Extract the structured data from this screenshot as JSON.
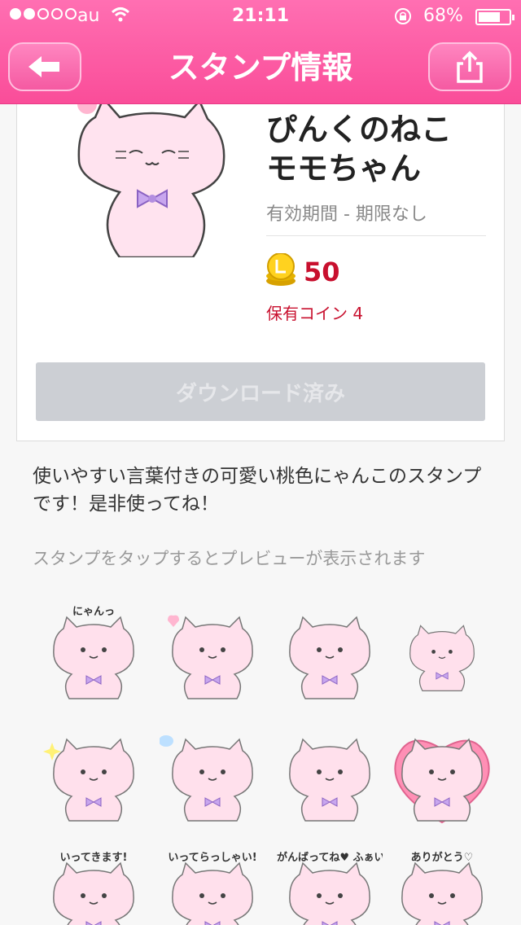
{
  "status_bar": {
    "carrier": "au",
    "time": "21:11",
    "battery": "68%",
    "battery_level": 0.68
  },
  "nav": {
    "title": "スタンプ情報",
    "back_icon": "back-arrow-icon",
    "share_icon": "share-icon"
  },
  "product": {
    "name_line1": "ぴんくのねこ",
    "name_line2": "モモちゃん",
    "validity": "有効期間 - 期限なし",
    "price": "50",
    "owned_coins": "保有コイン 4",
    "download_label": "ダウンロード済み"
  },
  "description": "使いやすい言葉付きの可愛い桃色にゃんこのスタンプです！是非使ってね！",
  "preview_hint": "スタンプをタップするとプレビューが表示されます",
  "colors": {
    "header": "#fa4d99",
    "price": "#c8102e",
    "cat_body": "#ffe3ef",
    "bow": "#b38ee0"
  },
  "stickers": [
    {
      "label": "にゃんっ",
      "variant": "happy"
    },
    {
      "label": "",
      "variant": "heart"
    },
    {
      "label": "",
      "variant": "surprised"
    },
    {
      "label": "",
      "variant": "small"
    },
    {
      "label": "",
      "variant": "sparkle"
    },
    {
      "label": "",
      "variant": "sad"
    },
    {
      "label": "",
      "variant": "walk"
    },
    {
      "label": "",
      "variant": "heart-cushion"
    },
    {
      "label": "いってきます!",
      "variant": "text"
    },
    {
      "label": "いってらっしゃい!",
      "variant": "text"
    },
    {
      "label": "がんばってね♥ ふぁいと",
      "variant": "text"
    },
    {
      "label": "ありがとう♡",
      "variant": "text"
    }
  ]
}
